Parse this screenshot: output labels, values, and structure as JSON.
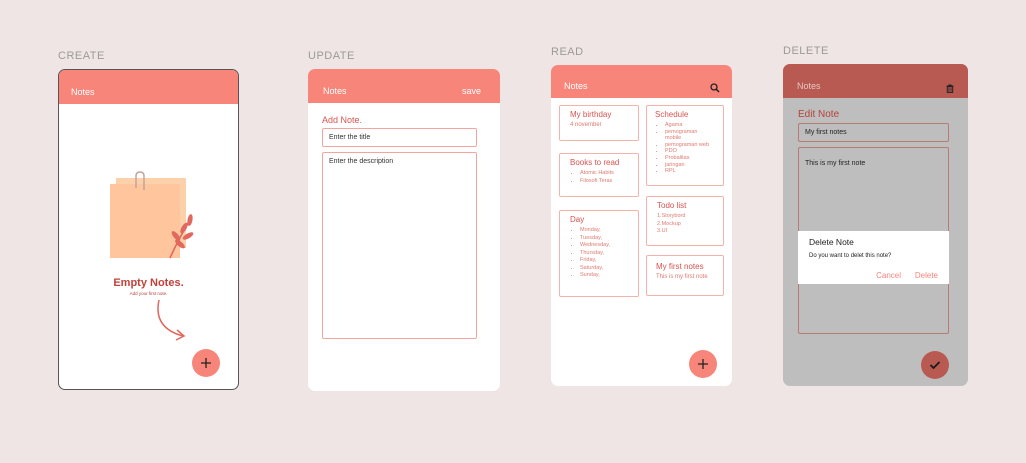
{
  "sections": {
    "create": "CREATE",
    "update": "UPDATE",
    "read": "READ",
    "delete": "DELETE"
  },
  "create_screen": {
    "app_title": "Notes",
    "empty_title": "Empty Notes.",
    "empty_subtitle": "Add your first note.",
    "fab_icon": "plus-icon"
  },
  "update_screen": {
    "app_title": "Notes",
    "save_label": "save",
    "heading": "Add Note.",
    "title_value": "Enter the title",
    "description_value": "Enter the description"
  },
  "read_screen": {
    "app_title": "Notes",
    "search_icon": "search-icon",
    "notes": {
      "birthday": {
        "title": "My birthday",
        "body": "4 november"
      },
      "books": {
        "title": "Books to read",
        "items": [
          "Atomic Habits",
          "Filosofi Teras"
        ]
      },
      "day": {
        "title": "Day",
        "items": [
          "Monday,",
          "Tuesday,",
          "Wednesday,",
          "Thursday,",
          "Friday,",
          "Saturday,",
          "Sunday,"
        ]
      },
      "schedule": {
        "title": "Schedule",
        "items": [
          "Agama",
          "pemograman mobile",
          "pemograman web",
          "PDO",
          "Probalitas",
          "jaringan",
          "RPL"
        ]
      },
      "todo": {
        "title": "Todo list",
        "lines": [
          "1.Storybord",
          "2.Mockup",
          "3.UI"
        ]
      },
      "first": {
        "title": "My first notes",
        "body": "This is my first note"
      }
    }
  },
  "delete_screen": {
    "app_title": "Notes",
    "heading": "Edit Note",
    "title_value": "My first notes",
    "body_value": "This is my first note",
    "dialog": {
      "title": "Delete Note",
      "message": "Do you want to delet this note?",
      "cancel": "Cancel",
      "confirm": "Delete"
    }
  },
  "colors": {
    "accent": "#f7857a",
    "accent_dark": "#b85a52",
    "text_accent": "#d9534f",
    "background": "#efe5e4",
    "overlay": "#bebebe"
  }
}
